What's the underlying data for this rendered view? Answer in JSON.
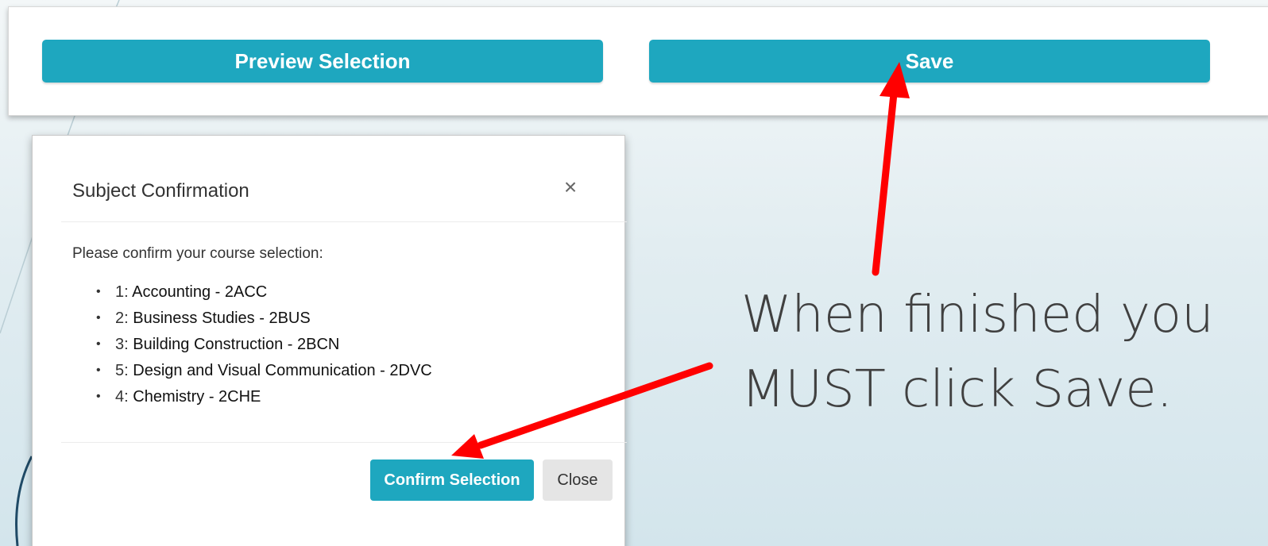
{
  "toolbar": {
    "preview_label": "Preview Selection",
    "save_label": "Save"
  },
  "modal": {
    "title": "Subject Confirmation",
    "close_icon": "×",
    "message": "Please confirm your course selection:",
    "courses": [
      {
        "number": "1:",
        "name": "Accounting - 2ACC"
      },
      {
        "number": "2:",
        "name": "Business Studies - 2BUS"
      },
      {
        "number": "3:",
        "name": "Building Construction - 2BCN"
      },
      {
        "number": "5:",
        "name": "Design and Visual Communication - 2DVC"
      },
      {
        "number": "4:",
        "name": "Chemistry - 2CHE"
      }
    ],
    "confirm_label": "Confirm Selection",
    "close_label": "Close"
  },
  "annotation": {
    "line1": "When finished you",
    "line2": "MUST click Save."
  },
  "colors": {
    "accent": "#1ea7bf",
    "arrow": "#ff0000",
    "secondary_button": "#e5e5e5"
  },
  "icons": {
    "close": "close-icon",
    "arrow": "arrow-annotation"
  }
}
